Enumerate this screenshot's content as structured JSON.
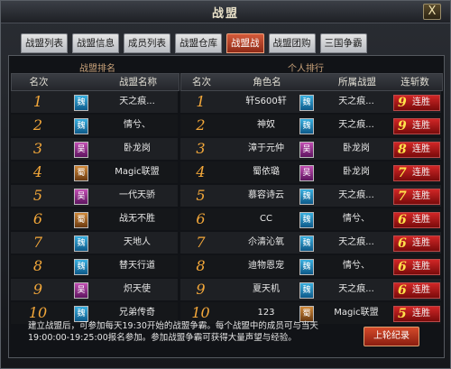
{
  "window": {
    "title": "战盟",
    "close_label": "X"
  },
  "tabs": [
    {
      "label": "战盟列表",
      "active": false
    },
    {
      "label": "战盟信息",
      "active": false
    },
    {
      "label": "成员列表",
      "active": false
    },
    {
      "label": "战盟仓库",
      "active": false
    },
    {
      "label": "战盟战",
      "active": true
    },
    {
      "label": "战盟团购",
      "active": false
    },
    {
      "label": "三国争霸",
      "active": false
    }
  ],
  "left": {
    "section": "战盟排名",
    "headers": [
      "名次",
      "战盟名称"
    ],
    "rows": [
      {
        "rank": "1",
        "faction": "魏",
        "faction_key": "wei",
        "name": "天之痕..."
      },
      {
        "rank": "2",
        "faction": "魏",
        "faction_key": "wei",
        "name": "情兮、"
      },
      {
        "rank": "3",
        "faction": "吴",
        "faction_key": "wu",
        "name": "卧龙岗"
      },
      {
        "rank": "4",
        "faction": "蜀",
        "faction_key": "shu",
        "name": "Magic联盟"
      },
      {
        "rank": "5",
        "faction": "吴",
        "faction_key": "wu",
        "name": "一代天骄"
      },
      {
        "rank": "6",
        "faction": "蜀",
        "faction_key": "shu",
        "name": "战无不胜"
      },
      {
        "rank": "7",
        "faction": "魏",
        "faction_key": "wei",
        "name": "天地人"
      },
      {
        "rank": "8",
        "faction": "魏",
        "faction_key": "wei",
        "name": "替天行道"
      },
      {
        "rank": "9",
        "faction": "吴",
        "faction_key": "wu",
        "name": "炽天使"
      },
      {
        "rank": "10",
        "faction": "魏",
        "faction_key": "wei",
        "name": "兄弟传奇"
      }
    ]
  },
  "right": {
    "section": "个人排行",
    "headers": [
      "名次",
      "角色名",
      "所属战盟",
      "连斩数"
    ],
    "streak_suffix": "连胜",
    "rows": [
      {
        "rank": "1",
        "role": "轩S600轩",
        "faction": "魏",
        "faction_key": "wei",
        "guild": "天之痕...",
        "streak": "9"
      },
      {
        "rank": "2",
        "role": "神奴",
        "faction": "魏",
        "faction_key": "wei",
        "guild": "天之痕...",
        "streak": "9"
      },
      {
        "rank": "3",
        "role": "漳于元仲",
        "faction": "吴",
        "faction_key": "wu",
        "guild": "卧龙岗",
        "streak": "8"
      },
      {
        "rank": "4",
        "role": "蜀依璐",
        "faction": "吴",
        "faction_key": "wu",
        "guild": "卧龙岗",
        "streak": "7"
      },
      {
        "rank": "5",
        "role": "慕容诗云",
        "faction": "魏",
        "faction_key": "wei",
        "guild": "天之痕...",
        "streak": "7"
      },
      {
        "rank": "6",
        "role": "CC",
        "faction": "魏",
        "faction_key": "wei",
        "guild": "情兮、",
        "streak": "6"
      },
      {
        "rank": "7",
        "role": "尒清沁氧",
        "faction": "魏",
        "faction_key": "wei",
        "guild": "天之痕...",
        "streak": "6"
      },
      {
        "rank": "8",
        "role": "迪物恩宠",
        "faction": "魏",
        "faction_key": "wei",
        "guild": "情兮、",
        "streak": "6"
      },
      {
        "rank": "9",
        "role": "夏天机",
        "faction": "魏",
        "faction_key": "wei",
        "guild": "天之痕...",
        "streak": "6"
      },
      {
        "rank": "10",
        "role": "123",
        "faction": "蜀",
        "faction_key": "shu",
        "guild": "Magic联盟",
        "streak": "5"
      }
    ]
  },
  "footer": {
    "text": "建立战盟后，可参加每天19:30开始的战盟争霸。每个战盟中的成员可与当天19:00:00-19:25:00报名参加。参加战盟争霸可获得大量声望与经验。",
    "last_round_button": "上轮纪录"
  },
  "colors": {
    "accent": "#d44a2a",
    "rank": "#f4a83a",
    "streak_number": "#ffe34a"
  }
}
